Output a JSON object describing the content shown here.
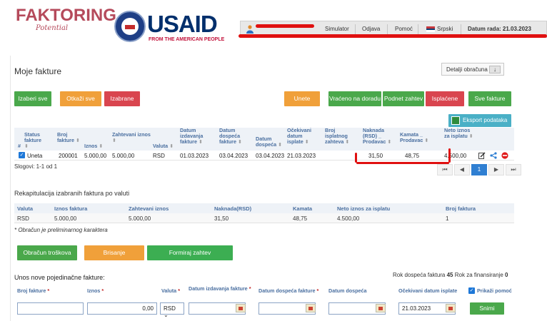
{
  "brand": {
    "factoring_title": "FAKTORING",
    "factoring_sub": "Potential",
    "usaid_title": "USAID",
    "usaid_sub": "FROM THE AMERICAN PEOPLE"
  },
  "topbar": {
    "simulator": "Simulator",
    "odjava": "Odjava",
    "pomoc": "Pomoć",
    "language": "Srpski",
    "datum_rada": "Datum rada: 21.03.2023"
  },
  "page": {
    "title": "Moje fakture",
    "detalji_label": "Detalji obračuna",
    "detalji_toggle": "↓"
  },
  "selection_buttons": {
    "izaberi_sve": "Izaberi sve",
    "otkazi_sve": "Otkaži sve",
    "izabrane": "Izabrane"
  },
  "filter_tabs": {
    "unete": "Unete",
    "vraceno": "Vraćeno na doradu",
    "podnet": "Podnet zahtev",
    "isplacene": "Isplaćene",
    "sve": "Sve fakture"
  },
  "export_label": "Eksport podataka",
  "table": {
    "headers": {
      "hash": "#",
      "status": "Status fakture",
      "broj": "Broj fakture",
      "iznos": "Iznos",
      "zahtevani": "Zahtevani iznos",
      "valuta": "Valuta",
      "datum_izdavanja": "Datum izdavanja fakture",
      "datum_dospeca_f": "Datum dospeća fakture",
      "datum_dospeca": "Datum dospeća",
      "ocekivani": "Očekivani datum isplate",
      "broj_isplatnog": "Broj isplatnog zahteva",
      "naknada": "Naknada (RSD) _ Prodavac",
      "kamata": "Kamata _ Prodavac",
      "neto": "Neto iznos za isplatu"
    },
    "rows": [
      {
        "status": "Uneta",
        "broj": "200001",
        "iznos": "5.000,00",
        "zahtevani": "5.000,00",
        "valuta": "RSD",
        "datum_izdavanja": "01.03.2023",
        "datum_dospeca_f": "03.04.2023",
        "datum_dospeca": "03.04.2023",
        "ocekivani": "21.03.2023",
        "broj_isplatnog": "",
        "naknada": "31,50",
        "kamata": "48,75",
        "neto": "4.500,00"
      }
    ],
    "records": "Slogovi: 1-1 od 1",
    "pager": {
      "first": "⏮",
      "prev": "◀",
      "current": "1",
      "next": "▶",
      "last": "⏭"
    }
  },
  "summary": {
    "title": "Rekapitulacija izabranih faktura po valuti",
    "headers": {
      "valuta": "Valuta",
      "iznos": "Iznos faktura",
      "zahtevani": "Zahtevani iznos",
      "naknada": "Naknada(RSD)",
      "kamata": "Kamata",
      "neto": "Neto iznos za isplatu",
      "broj": "Broj faktura"
    },
    "row": {
      "valuta": "RSD",
      "iznos": "5.000,00",
      "zahtevani": "5.000,00",
      "naknada": "31,50",
      "kamata": "48,75",
      "neto": "4.500,00",
      "broj": "1"
    },
    "note": "* Obračun je preliminarnog karaktera"
  },
  "action_buttons": {
    "obracun": "Obračun troškova",
    "brisanje": "Brisanje",
    "formiraj": "Formiraj zahtev"
  },
  "new_invoice": {
    "title": "Unos nove pojedinačne fakture:",
    "rok_dospeca_label": "Rok dospeća faktura",
    "rok_dospeca_value": "45",
    "rok_fin_label": "Rok za finansiranje",
    "rok_fin_value": "0",
    "labels": {
      "broj": "Broj fakture",
      "iznos": "Iznos",
      "valuta": "Valuta",
      "datum_izdavanja": "Datum izdavanja fakture",
      "datum_dospeca_f": "Datum dospeća fakture",
      "datum_dospeca": "Datum dospeća",
      "ocekivani": "Očekivani datum isplate",
      "prikazi_pomoc": "Prikaži pomoć"
    },
    "values": {
      "broj": "",
      "iznos": "0,00",
      "valuta": "RSD",
      "datum_izdavanja": "",
      "datum_dospeca_f": "",
      "datum_dospeca": "",
      "ocekivani": "21.03.2023"
    },
    "save": "Snimi"
  },
  "colors": {
    "green": "#4aa84b",
    "orange": "#f0a03a",
    "red": "#d9454f",
    "header_blue": "#4a6fa0",
    "pager_active": "#2f7fd2"
  }
}
